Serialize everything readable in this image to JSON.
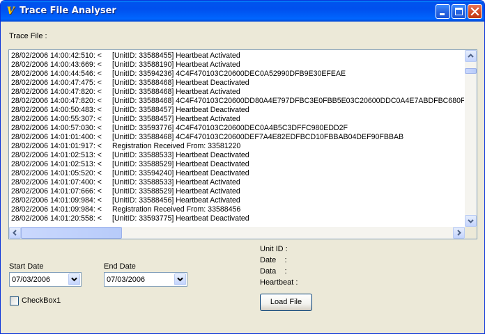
{
  "window": {
    "title": "Trace File Analyser",
    "icon": "delphi-app-icon"
  },
  "trace": {
    "label": "Trace File :",
    "lines": [
      {
        "ts": "28/02/2006 14:00:42:510: <",
        "msg": "[UnitID: 33588455] Heartbeat Activated"
      },
      {
        "ts": "28/02/2006 14:00:43:669: <",
        "msg": "[UnitID: 33588190] Heartbeat Activated"
      },
      {
        "ts": "28/02/2006 14:00:44:546: <",
        "msg": "[UnitID: 33594236] 4C4F470103C20600DEC0A52990DFB9E30EFEAE"
      },
      {
        "ts": "28/02/2006 14:00:47:475: <",
        "msg": "[UnitID: 33588468] Heartbeat Deactivated"
      },
      {
        "ts": "28/02/2006 14:00:47:820: <",
        "msg": "[UnitID: 33588468] Heartbeat Activated"
      },
      {
        "ts": "28/02/2006 14:00:47:820: <",
        "msg": "[UnitID: 33588468] 4C4F470103C20600DD80A4E797DFBC3E0FBB5E03C20600DDC0A4E7ABDFBC680F"
      },
      {
        "ts": "28/02/2006 14:00:50:483: <",
        "msg": "[UnitID: 33588457] Heartbeat Deactivated"
      },
      {
        "ts": "28/02/2006 14:00:55:307: <",
        "msg": "[UnitID: 33588457] Heartbeat Activated"
      },
      {
        "ts": "28/02/2006 14:00:57:030: <",
        "msg": "[UnitID: 33593776] 4C4F470103C20600DEC0A4B5C3DFFC980EDD2F"
      },
      {
        "ts": "28/02/2006 14:01:01:400: <",
        "msg": "[UnitID: 33588468] 4C4F470103C20600DEF7A4E82EDFBCD10FBBAB04DEF90FBBAB"
      },
      {
        "ts": "28/02/2006 14:01:01:917: <",
        "msg": "Registration Received From: 33581220"
      },
      {
        "ts": "28/02/2006 14:01:02:513: <",
        "msg": "[UnitID: 33588533] Heartbeat Deactivated"
      },
      {
        "ts": "28/02/2006 14:01:02:513: <",
        "msg": "[UnitID: 33588529] Heartbeat Deactivated"
      },
      {
        "ts": "28/02/2006 14:01:05:520: <",
        "msg": "[UnitID: 33594240] Heartbeat Deactivated"
      },
      {
        "ts": "28/02/2006 14:01:07:400: <",
        "msg": "[UnitID: 33588533] Heartbeat Activated"
      },
      {
        "ts": "28/02/2006 14:01:07:666: <",
        "msg": "[UnitID: 33588529] Heartbeat Activated"
      },
      {
        "ts": "28/02/2006 14:01:09:984: <",
        "msg": "[UnitID: 33588456] Heartbeat Activated"
      },
      {
        "ts": "28/02/2006 14:01:09:984: <",
        "msg": "Registration Received From: 33588456"
      },
      {
        "ts": "28/02/2006 14:01:20:558: <",
        "msg": "[UnitID: 33593775] Heartbeat Deactivated"
      }
    ]
  },
  "filters": {
    "start_label": "Start Date",
    "start_value": "07/03/2006",
    "end_label": "End Date",
    "end_value": "07/03/2006",
    "checkbox_label": "CheckBox1"
  },
  "details": {
    "unit_id_label": "Unit ID :",
    "date_label": "Date    :",
    "data_label": "Data    :",
    "heartbeat_label": "Heartbeat :"
  },
  "actions": {
    "load_label": "Load File"
  },
  "colors": {
    "titlebar": "#0053ee",
    "window_bg": "#ece9d8",
    "close_button": "#d24b25"
  }
}
